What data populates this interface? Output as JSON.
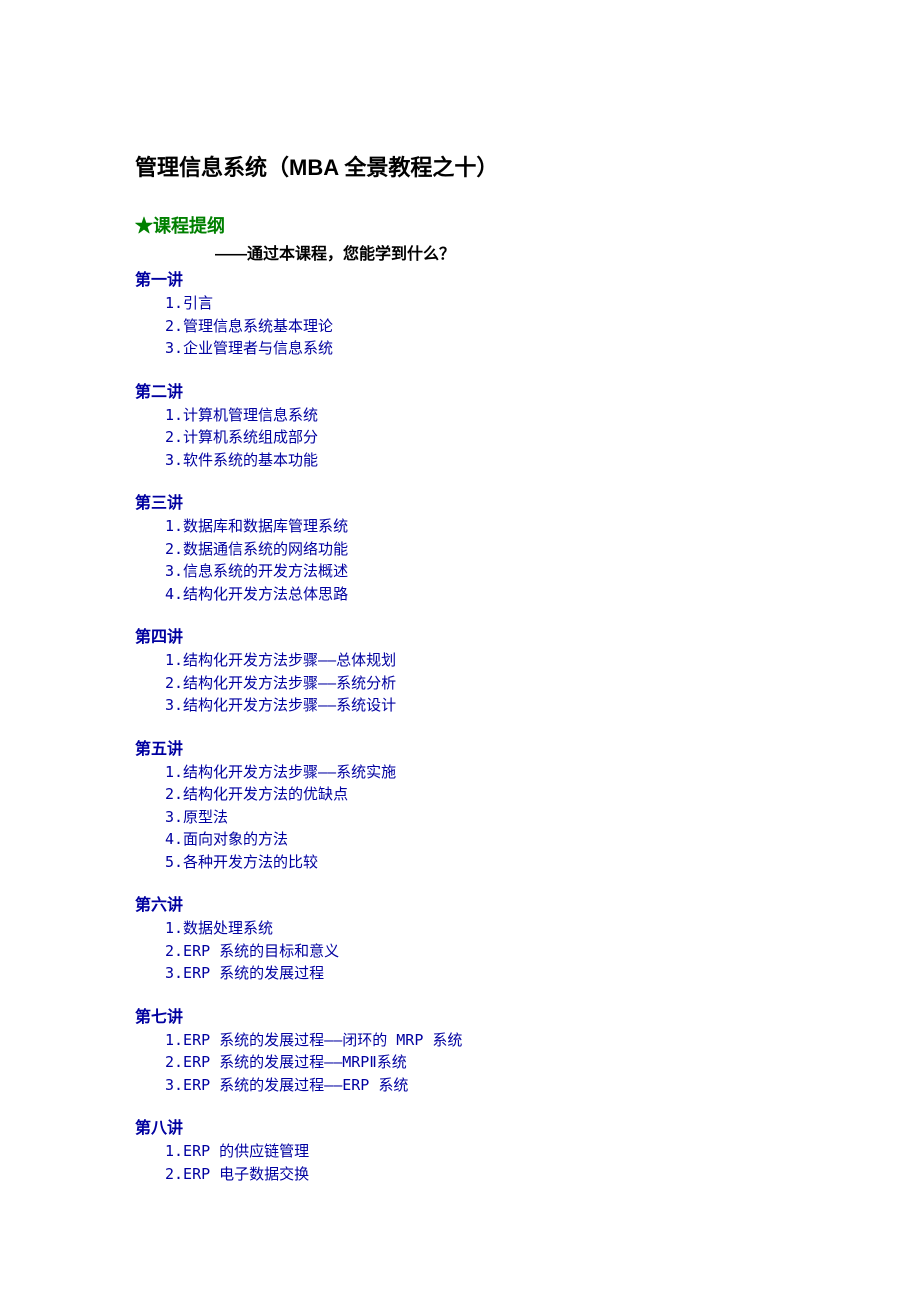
{
  "title": "管理信息系统（MBA 全景教程之十）",
  "outline_heading": "★课程提纲",
  "outline_subtitle": "——通过本课程，您能学到什么？",
  "lectures": [
    {
      "heading": "第一讲",
      "items": [
        "1.引言",
        "2.管理信息系统基本理论",
        "3.企业管理者与信息系统"
      ]
    },
    {
      "heading": "第二讲",
      "items": [
        "1.计算机管理信息系统",
        "2.计算机系统组成部分",
        "3.软件系统的基本功能"
      ]
    },
    {
      "heading": "第三讲",
      "items": [
        "1.数据库和数据库管理系统",
        "2.数据通信系统的网络功能",
        "3.信息系统的开发方法概述",
        "4.结构化开发方法总体思路"
      ]
    },
    {
      "heading": "第四讲",
      "items": [
        "1.结构化开发方法步骤——总体规划",
        "2.结构化开发方法步骤——系统分析",
        "3.结构化开发方法步骤——系统设计"
      ]
    },
    {
      "heading": "第五讲",
      "items": [
        "1.结构化开发方法步骤——系统实施",
        "2.结构化开发方法的优缺点",
        "3.原型法",
        "4.面向对象的方法",
        "5.各种开发方法的比较"
      ]
    },
    {
      "heading": "第六讲",
      "items": [
        "1.数据处理系统",
        "2.ERP 系统的目标和意义",
        "3.ERP 系统的发展过程"
      ]
    },
    {
      "heading": "第七讲",
      "items": [
        "1.ERP 系统的发展过程——闭环的 MRP 系统",
        "2.ERP 系统的发展过程——MRPⅡ系统",
        "3.ERP 系统的发展过程——ERP 系统"
      ]
    },
    {
      "heading": "第八讲",
      "items": [
        "1.ERP 的供应链管理",
        "2.ERP 电子数据交换"
      ]
    }
  ]
}
